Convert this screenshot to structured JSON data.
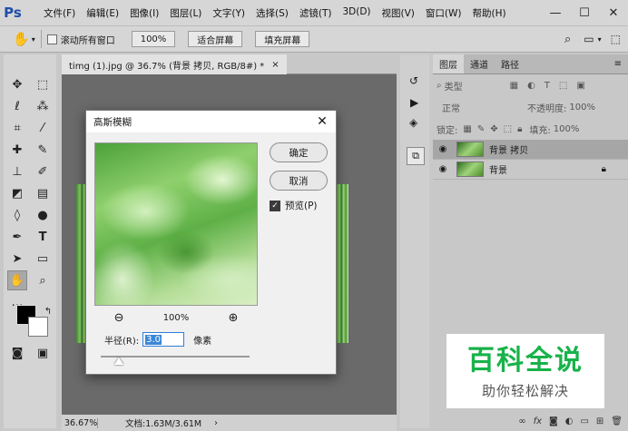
{
  "app": {
    "logo": "Ps"
  },
  "menu": [
    "文件(F)",
    "编辑(E)",
    "图像(I)",
    "图层(L)",
    "文字(Y)",
    "选择(S)",
    "滤镜(T)",
    "3D(D)",
    "视图(V)",
    "窗口(W)",
    "帮助(H)"
  ],
  "window_controls": {
    "minimize": "—",
    "maximize": "☐",
    "close": "✕"
  },
  "options_bar": {
    "scroll_all_label": "滚动所有窗口",
    "zoom_value": "100%",
    "fit_screen": "适合屏幕",
    "fill_screen": "填充屏幕"
  },
  "document": {
    "tab_title": "timg (1).jpg @ 36.7% (背景 拷贝, RGB/8#) *",
    "tab_close": "×",
    "status_zoom": "36.67%",
    "status_doc": "文档:1.63M/3.61M"
  },
  "layers_panel": {
    "tabs": [
      "图层",
      "通道",
      "路径"
    ],
    "filter_kind": "类型",
    "blend_mode": "正常",
    "opacity_label": "不透明度:",
    "opacity_value": "100%",
    "lock_label": "锁定:",
    "fill_label": "填充:",
    "fill_value": "100%",
    "layers": [
      {
        "name": "背景 拷贝",
        "selected": true
      },
      {
        "name": "背景",
        "selected": false
      }
    ]
  },
  "dialog": {
    "title": "高斯模糊",
    "ok": "确定",
    "cancel": "取消",
    "preview_label": "预览(P)",
    "preview_checked": true,
    "zoom": "100%",
    "zoom_out": "⊖",
    "zoom_in": "⊕",
    "radius_label": "半径(R):",
    "radius_value": "3.0",
    "radius_unit": "像素",
    "radius_slider_fraction": 0.12
  },
  "watermark": {
    "main": "百科全说",
    "sub": "助你轻松解决"
  },
  "colors": {
    "accent": "#18b24a",
    "ps_blue": "#1f4ea8",
    "selection_blue": "#3b86d8"
  }
}
